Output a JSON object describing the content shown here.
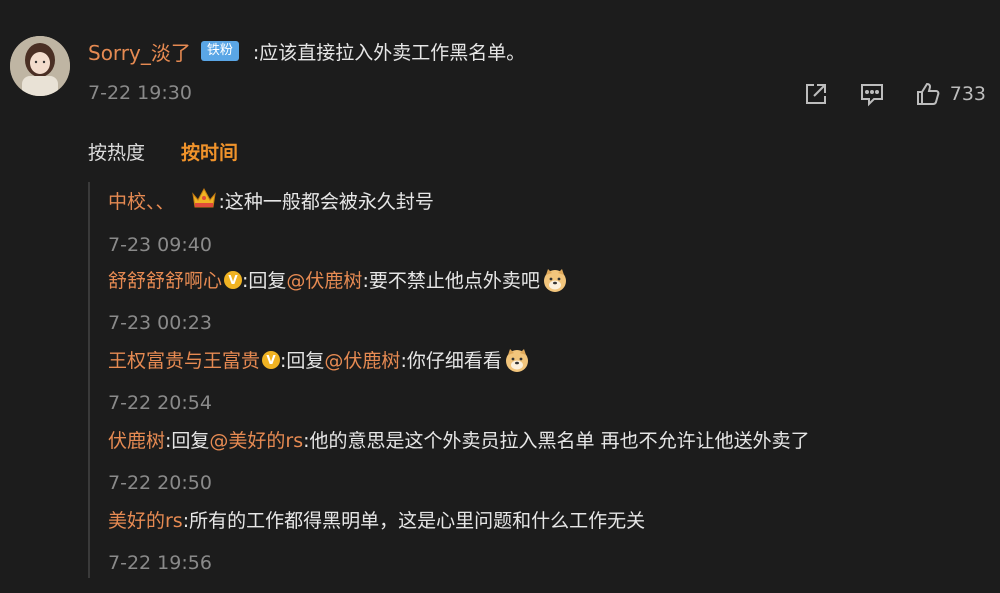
{
  "comment": {
    "author": "Sorry_淡了",
    "badge": "铁粉",
    "text": ":应该直接拉入外卖工作黑名单。",
    "time": "7-22 19:30",
    "like_count": "733",
    "icons": [
      "share-icon",
      "comment-icon",
      "like-icon"
    ]
  },
  "sort": {
    "by_hot": "按热度",
    "by_time": "按时间",
    "active": "by_time"
  },
  "replies": [
    {
      "name": "中校、、",
      "badge_icon": "crown-icon",
      "text": ":这种一般都会被永久封号",
      "time": "7-23 09:40"
    },
    {
      "name": "舒舒舒舒啊心",
      "vip": "V",
      "reply_prefix": ":回复",
      "mention": "@伏鹿树",
      "text": ":要不禁止他点外卖吧",
      "emoji": "doge-icon",
      "time": "7-23 00:23"
    },
    {
      "name": "王权富贵与王富贵",
      "vip": "V",
      "reply_prefix": ":回复",
      "mention": "@伏鹿树",
      "text": ":你仔细看看",
      "emoji": "doge-icon",
      "time": "7-22 20:54"
    },
    {
      "name": "伏鹿树",
      "reply_prefix": ":回复",
      "mention": "@美好的rs",
      "text": ":他的意思是这个外卖员拉入黑名单 再也不允许让他送外卖了",
      "time": "7-22 20:50"
    },
    {
      "name": "美好的rs",
      "text": ":所有的工作都得黑明单，这是心里问题和什么工作无关",
      "time": "7-22 19:56"
    }
  ],
  "colors": {
    "background": "#1c1c1c",
    "username": "#e68a52",
    "active_tab": "#f0932b",
    "timestamp": "#8a8a8a",
    "fan_badge": "#5aa6e6"
  }
}
